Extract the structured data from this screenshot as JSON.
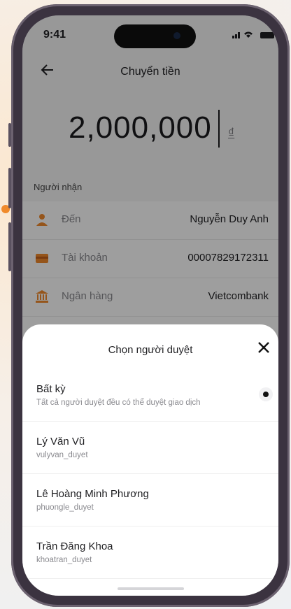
{
  "status": {
    "time": "9:41",
    "signal": ".. l"
  },
  "header": {
    "back_icon": "arrow-left-icon",
    "title": "Chuyển tiền"
  },
  "amount": {
    "value": "2,000,000",
    "currency": "₫"
  },
  "recipient": {
    "section_label": "Người nhận",
    "rows": [
      {
        "icon": "person-icon",
        "label": "Đến",
        "value": "Nguyễn Duy Anh"
      },
      {
        "icon": "card-icon",
        "label": "Tài khoản",
        "value": "00007829172311"
      },
      {
        "icon": "bank-icon",
        "label": "Ngân hàng",
        "value": "Vietcombank"
      }
    ]
  },
  "sheet": {
    "title": "Chọn người duyệt",
    "options": [
      {
        "name": "Bất kỳ",
        "sub": "Tất cả người duyệt đều có thể duyệt giao dịch",
        "selected": true
      },
      {
        "name": "Lý Văn Vũ",
        "sub": "vulyvan_duyet"
      },
      {
        "name": "Lê Hoàng Minh Phương",
        "sub": "phuongle_duyet"
      },
      {
        "name": "Trần Đăng Khoa",
        "sub": "khoatran_duyet"
      }
    ]
  },
  "colors": {
    "accent": "#f08a2c",
    "frame": "#3b3340"
  }
}
